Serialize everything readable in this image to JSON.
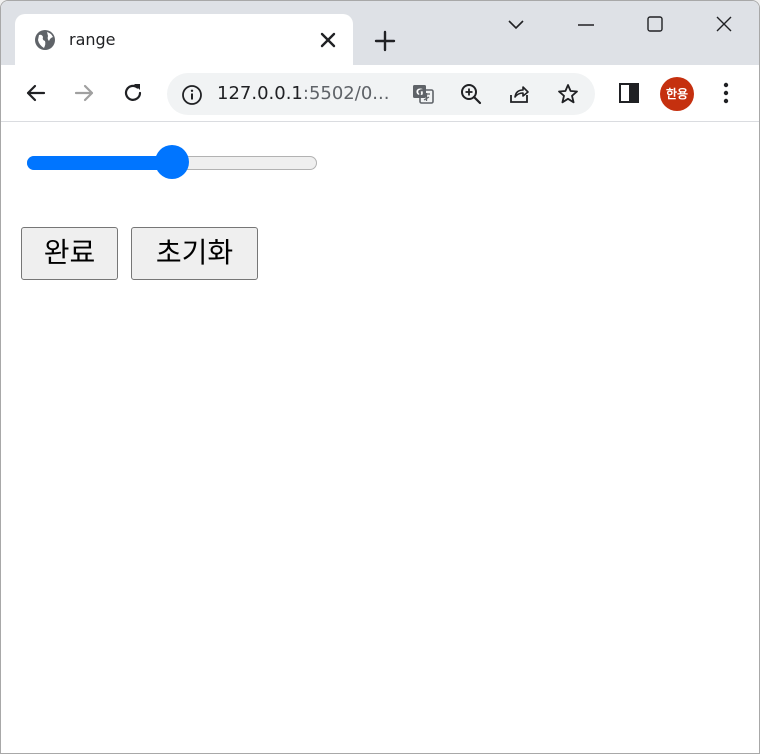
{
  "browser": {
    "tab": {
      "title": "range",
      "favicon": "globe-icon"
    },
    "address": {
      "url_host": "127.0.0.1",
      "url_rest": ":5502/0..."
    },
    "profile": {
      "label": "한용",
      "color": "#c5300f"
    }
  },
  "page": {
    "slider": {
      "value": 50,
      "min": 0,
      "max": 100,
      "accent": "#0075ff"
    },
    "buttons": {
      "done_label": "완료",
      "reset_label": "초기화"
    }
  }
}
